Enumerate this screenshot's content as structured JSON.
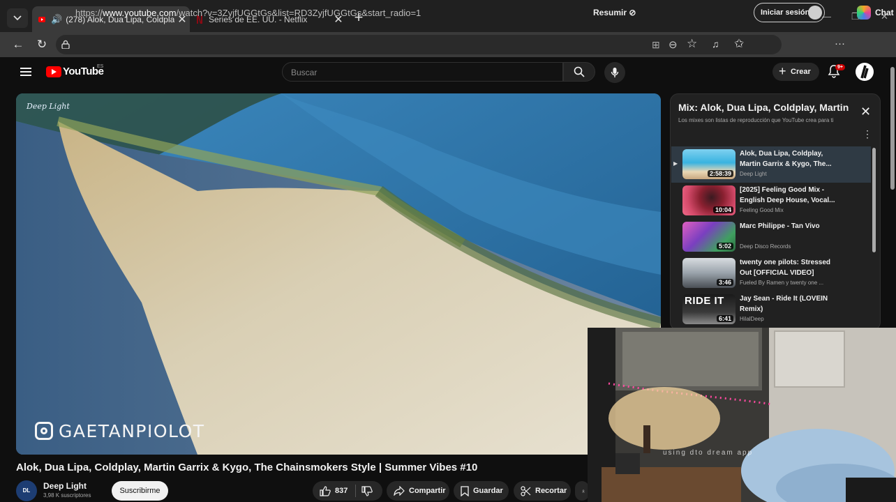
{
  "browser": {
    "tabs": [
      {
        "title": "(278) Alok, Dua Lipa, Coldplay",
        "active": true,
        "audio": true
      },
      {
        "title": "Series de EE. UU. - Netflix",
        "active": false
      }
    ],
    "url_prefix": "https://",
    "url_host": "www.youtube.com",
    "url_path": "/watch?v=3ZyjfUGGtGs&list=RD3ZyjfUGGtGs&start_radio=1",
    "resumir_label": "Resumir",
    "signin_label": "Iniciar sesión",
    "chat_label": "Chat"
  },
  "youtube": {
    "logo_text": "YouTube",
    "country": "ES",
    "search_placeholder": "Buscar",
    "create_label": "Crear",
    "notif_count": "9+"
  },
  "video": {
    "title": "Alok, Dua Lipa, Coldplay, Martin Garrix & Kygo, The Chainsmokers Style | Summer Vibes #10",
    "watermark_top": "Deep Light",
    "watermark_bottom": "GAETANPIOLOT",
    "channel_name": "Deep Light",
    "channel_avatar_text": "DL",
    "channel_subs": "3,98 K suscriptores",
    "subscribe_label": "Suscribirme",
    "likes": "837",
    "share_label": "Compartir",
    "save_label": "Guardar",
    "clip_label": "Recortar"
  },
  "playlist": {
    "title": "Mix: Alok, Dua Lipa, Coldplay, Martin Garrix & Kygo...",
    "subtitle": "Los mixes son listas de reproducción que YouTube crea para ti",
    "items": [
      {
        "title": "Alok, Dua Lipa, Coldplay, Martin Garrix & Kygo, The...",
        "channel": "Deep Light",
        "duration": "2:58:39",
        "current": true,
        "thumb": "beach"
      },
      {
        "title": "[2025] Feeling Good Mix - English Deep House, Vocal...",
        "channel": "Feeling Good Mix",
        "duration": "10:04",
        "current": false,
        "thumb": "woman"
      },
      {
        "title": "Marc Philippe - Tan Vivo",
        "channel": "Deep Disco Records",
        "duration": "5:02",
        "current": false,
        "thumb": "city"
      },
      {
        "title": "twenty one pilots: Stressed Out [OFFICIAL VIDEO]",
        "channel": "Fueled By Ramen y twenty one ...",
        "duration": "3:46",
        "current": false,
        "thumb": "street"
      },
      {
        "title": "Jay Sean - Ride It (LOVEIN Remix)",
        "channel": "HilalDeep",
        "duration": "6:41",
        "current": false,
        "thumb": "rideit",
        "thumb_text": "RIDE IT"
      }
    ]
  },
  "webcam": {
    "overlay_text": "using dto dream app"
  }
}
